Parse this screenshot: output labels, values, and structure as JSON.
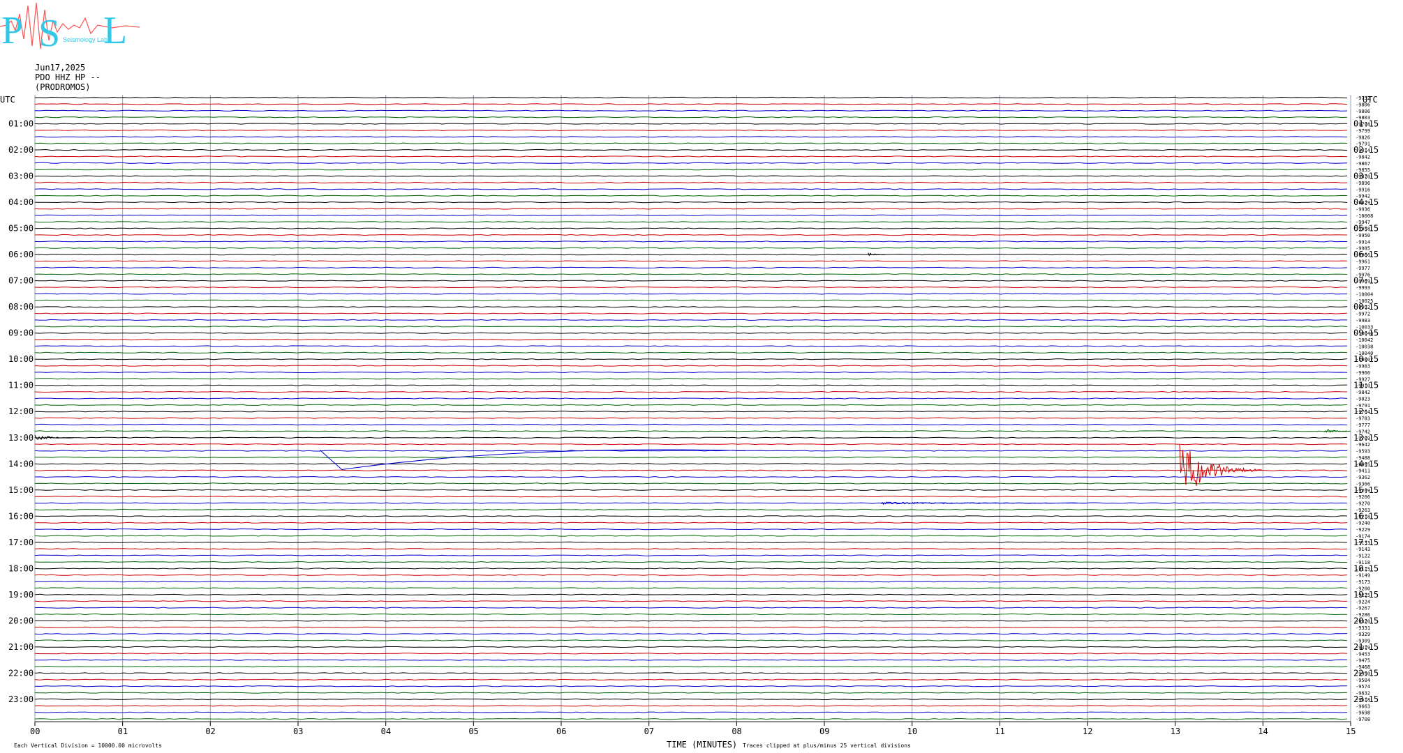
{
  "header": {
    "logo_letters": "PSL",
    "logo_text": "Seismology Lab",
    "date": "Jun17,2025",
    "station": "PDO HHZ HP --",
    "site": "(PRODROMOS)"
  },
  "chart_data": {
    "type": "line",
    "utc_label_left": "UTC",
    "utc_label_right": "UTC",
    "left_hours": [
      "01:00",
      "02:00",
      "03:00",
      "04:00",
      "05:00",
      "06:00",
      "07:00",
      "08:00",
      "09:00",
      "10:00",
      "11:00",
      "12:00",
      "13:00",
      "14:00",
      "15:00",
      "16:00",
      "17:00",
      "18:00",
      "19:00",
      "20:00",
      "21:00",
      "22:00",
      "23:00"
    ],
    "right_hours": [
      "01:15",
      "02:15",
      "03:15",
      "04:15",
      "05:15",
      "06:15",
      "07:15",
      "08:15",
      "09:15",
      "10:15",
      "11:15",
      "12:15",
      "13:15",
      "14:15",
      "15:15",
      "16:15",
      "17:15",
      "18:15",
      "19:15",
      "20:15",
      "21:15",
      "22:15",
      "23:15"
    ],
    "trace_values": [
      "-9752",
      "-9806",
      "-9806",
      "-9803",
      "-9798",
      "-9799",
      "-9826",
      "-9791",
      "-9814",
      "-9842",
      "-9867",
      "-9855",
      "-9870",
      "-9896",
      "-9916",
      "-9942",
      "-9929",
      "-9936",
      "-10008",
      "-9947",
      "-9958",
      "-9950",
      "-9914",
      "-9985",
      "-9966",
      "-9961",
      "-9977",
      "-9976",
      "-9969",
      "-9993",
      "-10004",
      "-10025",
      "-9992",
      "-9972",
      "-9983",
      "-10033",
      "-10040",
      "-10042",
      "-10038",
      "-10040",
      "-10007",
      "-9983",
      "-9966",
      "-9927",
      "-9910",
      "-9842",
      "-9823",
      "-9791",
      "-9764",
      "-9783",
      "-9777",
      "-9742",
      "-9709",
      "-9642",
      "-9593",
      "-9488",
      "-9495",
      "-9411",
      "-9362",
      "-9366",
      "-9299",
      "-9206",
      "-9270",
      "-9263",
      "-9218",
      "-9240",
      "-9229",
      "-9174",
      "-9133",
      "-9143",
      "-9122",
      "-9118",
      "-9115",
      "-9149",
      "-9173",
      "-9200",
      "-9225",
      "-9224",
      "-9267",
      "-9286",
      "-9320",
      "-9331",
      "-9329",
      "-9309",
      "-9319",
      "-9453",
      "-9475",
      "-9468",
      "-9450",
      "-9504",
      "-9574",
      "-9632",
      "-9618",
      "-9663",
      "-9698",
      "-9708"
    ],
    "trace_colors": [
      "#000000",
      "#cc0000",
      "#0000cc",
      "#006600"
    ],
    "x_ticks": [
      "00",
      "01",
      "02",
      "03",
      "04",
      "05",
      "06",
      "07",
      "08",
      "09",
      "10",
      "11",
      "12",
      "13",
      "14",
      "15"
    ],
    "xlim": [
      0,
      15
    ],
    "xlabel": "TIME (MINUTES)",
    "footer_left": "Each Vertical Division = 10000.00 microvolts",
    "footer_right": "Traces clipped at plus/minus 25 vertical divisions",
    "grid": true,
    "events": [
      {
        "trace": 52,
        "x_start": 0.0,
        "x_end": 0.45,
        "amplitude": 5
      },
      {
        "trace": 51,
        "x_start": 14.7,
        "x_end": 15.0,
        "amplitude": 4
      },
      {
        "trace": 54,
        "x_start": 3.25,
        "x_end": 8.1,
        "kind": "drift"
      },
      {
        "trace": 57,
        "x_start": 13.05,
        "x_end": 14.0,
        "amplitude": 45
      },
      {
        "trace": 62,
        "x_start": 9.65,
        "x_end": 12.0,
        "amplitude": 2
      },
      {
        "trace": 24,
        "x_start": 9.5,
        "x_end": 9.7,
        "amplitude": 3
      }
    ]
  }
}
